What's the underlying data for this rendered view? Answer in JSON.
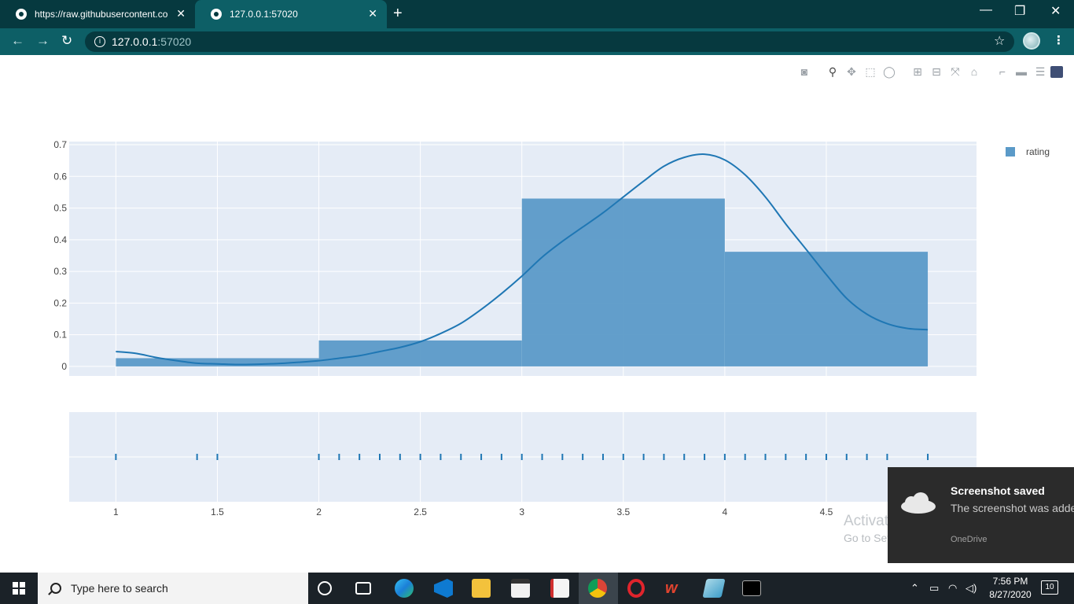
{
  "browser": {
    "tabs": [
      {
        "title": "https://raw.githubusercontent.co",
        "active": false
      },
      {
        "title": "127.0.0.1:57020",
        "active": true
      }
    ],
    "url_host": "127.0.0.1",
    "url_port": ":57020",
    "new_tab": "+",
    "close": "✕",
    "window_controls": [
      "—",
      "❐",
      "✕"
    ]
  },
  "plot": {
    "modebar_icons": [
      "camera-icon",
      "zoom-icon",
      "pan-icon",
      "box-select-icon",
      "lasso-icon",
      "zoom-in-icon",
      "zoom-out-icon",
      "autoscale-icon",
      "reset-axes-icon",
      "spike-lines-icon",
      "hover-closest-icon",
      "hover-compare-icon",
      "plotly-logo-icon"
    ],
    "legend": [
      {
        "name": "rating",
        "color": "#5b9ac8"
      }
    ]
  },
  "chart_data": {
    "type": "bar",
    "subtype": "distplot (histogram + kde + rug)",
    "bar_color": "#5b9ac8",
    "line_color": "#1f77b4",
    "plot_bg": "#e5ecf6",
    "xlim": [
      0.77,
      5.24
    ],
    "ylim": [
      -0.03,
      0.71
    ],
    "x_ticks": [
      "1",
      "1.5",
      "2",
      "2.5",
      "3",
      "3.5",
      "4",
      "4.5"
    ],
    "y_ticks": [
      "0",
      "0.1",
      "0.2",
      "0.3",
      "0.4",
      "0.5",
      "0.6",
      "0.7"
    ],
    "histogram": [
      {
        "x0": 1,
        "x1": 2,
        "value": 0.026
      },
      {
        "x0": 2,
        "x1": 3,
        "value": 0.082
      },
      {
        "x0": 3,
        "x1": 4,
        "value": 0.53
      },
      {
        "x0": 4,
        "x1": 5,
        "value": 0.362
      }
    ],
    "kde": {
      "x": [
        1.0,
        1.1,
        1.2,
        1.3,
        1.4,
        1.5,
        1.6,
        1.7,
        1.8,
        1.9,
        2.0,
        2.1,
        2.2,
        2.3,
        2.4,
        2.5,
        2.6,
        2.7,
        2.8,
        2.9,
        3.0,
        3.1,
        3.2,
        3.3,
        3.4,
        3.5,
        3.6,
        3.7,
        3.8,
        3.9,
        4.0,
        4.1,
        4.2,
        4.3,
        4.4,
        4.5,
        4.6,
        4.7,
        4.8,
        4.9,
        5.0
      ],
      "y": [
        0.047,
        0.041,
        0.028,
        0.018,
        0.01,
        0.008,
        0.006,
        0.007,
        0.009,
        0.013,
        0.018,
        0.026,
        0.034,
        0.047,
        0.06,
        0.078,
        0.104,
        0.136,
        0.18,
        0.23,
        0.285,
        0.345,
        0.395,
        0.44,
        0.485,
        0.535,
        0.585,
        0.632,
        0.66,
        0.67,
        0.652,
        0.605,
        0.535,
        0.45,
        0.37,
        0.29,
        0.215,
        0.165,
        0.135,
        0.12,
        0.116
      ]
    },
    "rug_x": [
      1.0,
      1.4,
      1.5,
      2.0,
      2.1,
      2.2,
      2.3,
      2.4,
      2.5,
      2.6,
      2.7,
      2.8,
      2.9,
      3.0,
      3.1,
      3.2,
      3.3,
      3.4,
      3.5,
      3.6,
      3.7,
      3.8,
      3.9,
      4.0,
      4.1,
      4.2,
      4.3,
      4.4,
      4.5,
      4.6,
      4.7,
      4.8,
      5.0
    ]
  },
  "watermark": {
    "line1": "Activate Windows",
    "line2": "Go to Settings to activate Windows."
  },
  "toast": {
    "title": "Screenshot saved",
    "message": "The screenshot was added to OneDrive.",
    "source": "OneDrive"
  },
  "taskbar": {
    "search_placeholder": "Type here to search",
    "apps": [
      "cortana-icon",
      "task-view-icon",
      "edge-icon",
      "vscode-icon",
      "file-explorer-icon",
      "store-icon",
      "pdf-icon",
      "chrome-icon",
      "opera-icon",
      "wps-icon",
      "notepad-icon",
      "terminal-icon"
    ],
    "time": "7:56 PM",
    "date": "8/27/2020",
    "notifications": "10"
  }
}
